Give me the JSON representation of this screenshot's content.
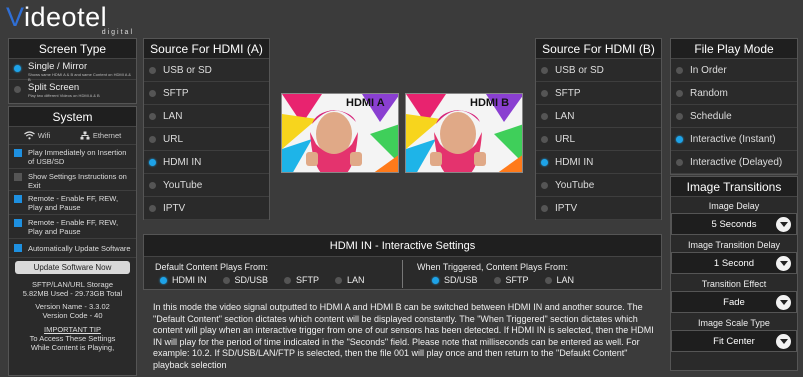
{
  "brand": {
    "name_part1": "V",
    "name_part2": "ideotel",
    "tagline": "digital"
  },
  "screen_type": {
    "title": "Screen Type",
    "options": [
      {
        "label": "Single / Mirror",
        "desc": "Shows same HDMI A & B and same Content on HDMI A & B",
        "selected": true
      },
      {
        "label": "Split Screen",
        "desc": "Play two different Videos on HDMI A & B",
        "selected": false
      }
    ]
  },
  "system": {
    "title": "System",
    "wifi_label": "Wifi",
    "ethernet_label": "Ethernet",
    "checkboxes": [
      {
        "label": "Play Immediately on Insertion of USB/SD",
        "checked": true
      },
      {
        "label": "Show Settings Instructions on Exit",
        "checked": false
      },
      {
        "label": "Remote - Enable FF, REW, Play and Pause",
        "checked": true
      },
      {
        "label": "Remote - Enable FF, REW, Play and Pause",
        "checked": true
      },
      {
        "label": "Automatically Update Software",
        "checked": true
      }
    ],
    "update_button": "Update Software Now",
    "storage_line1": "SFTP/LAN/URL Storage",
    "storage_line2": "5.82MB Used - 29.73GB Total",
    "version_name": "Version Name - 3.3.02",
    "version_code": "Version Code - 40",
    "tip_title": "IMPORTANT TIP",
    "tip_line1": "To Access These Settings",
    "tip_line2": "While Content is Playing,"
  },
  "source_a": {
    "title": "Source For HDMI (A)",
    "options": [
      {
        "label": "USB or SD",
        "selected": false
      },
      {
        "label": "SFTP",
        "selected": false
      },
      {
        "label": "LAN",
        "selected": false
      },
      {
        "label": "URL",
        "selected": false
      },
      {
        "label": "HDMI IN",
        "selected": true
      },
      {
        "label": "YouTube",
        "selected": false
      },
      {
        "label": "IPTV",
        "selected": false
      }
    ]
  },
  "source_b": {
    "title": "Source For HDMI (B)",
    "options": [
      {
        "label": "USB or SD",
        "selected": false
      },
      {
        "label": "SFTP",
        "selected": false
      },
      {
        "label": "LAN",
        "selected": false
      },
      {
        "label": "URL",
        "selected": false
      },
      {
        "label": "HDMI IN",
        "selected": true
      },
      {
        "label": "YouTube",
        "selected": false
      },
      {
        "label": "IPTV",
        "selected": false
      }
    ]
  },
  "previews": {
    "a_label": "HDMI A",
    "b_label": "HDMI B"
  },
  "interactive": {
    "title": "HDMI IN - Interactive Settings",
    "default_label": "Default Content Plays From:",
    "default_options": [
      {
        "label": "HDMI IN",
        "selected": true
      },
      {
        "label": "SD/USB",
        "selected": false
      },
      {
        "label": "SFTP",
        "selected": false
      },
      {
        "label": "LAN",
        "selected": false
      }
    ],
    "trigger_label": "When Triggered, Content Plays From:",
    "trigger_options": [
      {
        "label": "SD/USB",
        "selected": true
      },
      {
        "label": "SFTP",
        "selected": false
      },
      {
        "label": "LAN",
        "selected": false
      }
    ],
    "description": "In this mode the video signal outputted to HDMI A and HDMI B can be switched between HDMI IN and another source. The \"Default Content\" section dictates which content will be displayed constantly. The \"When Triggered\" section dictates which content will play when an interactive trigger from one of our sensors has been detected. If HDMI IN is selected, then the HDMI IN will play for the period of time indicated in the \"Seconds\" field. Please note that milliseconds can be entered as well. For example: 10.2. If SD/USB/LAN/FTP is selected, then the file 001 will play once and then return to the \"Defaukt Content\" playback selection"
  },
  "file_play_mode": {
    "title": "File Play Mode",
    "options": [
      {
        "label": "In Order",
        "selected": false
      },
      {
        "label": "Random",
        "selected": false
      },
      {
        "label": "Schedule",
        "selected": false
      },
      {
        "label": "Interactive  (Instant)",
        "selected": true
      },
      {
        "label": "Interactive  (Delayed)",
        "selected": false
      }
    ]
  },
  "image_transitions": {
    "title": "Image Transitions",
    "delay_label": "Image Delay",
    "delay_value": "5 Seconds",
    "transition_delay_label": "Image Transition Delay",
    "transition_delay_value": "1 Second",
    "effect_label": "Transition Effect",
    "effect_value": "Fade",
    "scale_label": "Image Scale Type",
    "scale_value": "Fit Center"
  },
  "colors": {
    "accent": "#1ea3e8",
    "brand_blue": "#2f6fd6",
    "panel": "#2a2a2a"
  }
}
